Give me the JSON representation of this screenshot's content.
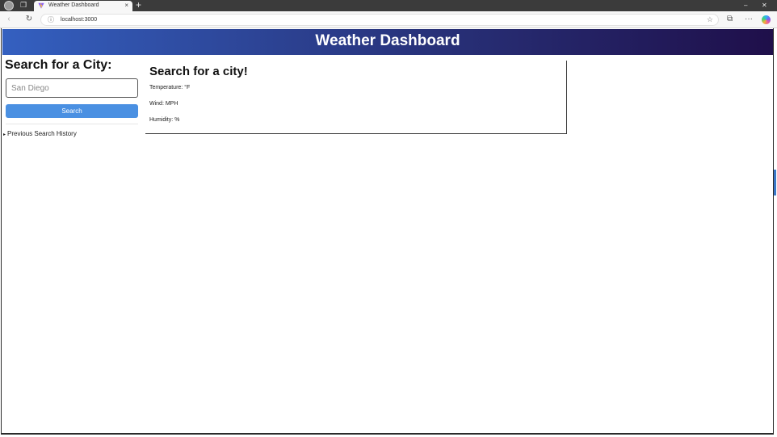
{
  "browser": {
    "tab_title": "Weather Dashboard",
    "tab_close": "×",
    "new_tab": "+",
    "address": "localhost:3000",
    "info_icon": "info-icon",
    "back": "‹",
    "reload": "↻",
    "favorite": "☆",
    "extensions": "⧉",
    "more": "···",
    "minimize": "–",
    "close": "✕"
  },
  "header": {
    "title": "Weather Dashboard"
  },
  "sidebar": {
    "title": "Search for a City:",
    "input_value": "",
    "input_placeholder": "San Diego",
    "search_button": "Search",
    "history_toggle": "▸",
    "history_label": "Previous Search History"
  },
  "weather": {
    "title": "Search for a city!",
    "temperature": "Temperature: °F",
    "wind": "Wind: MPH",
    "humidity": "Humidity: %"
  },
  "colors": {
    "header_start": "#3460c0",
    "header_end": "#1f0f4a",
    "button": "#4a90e2"
  }
}
